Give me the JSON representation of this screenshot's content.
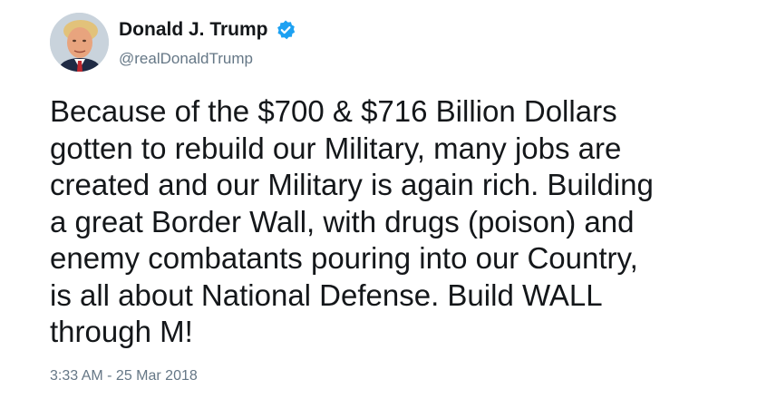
{
  "tweet": {
    "display_name": "Donald J. Trump",
    "handle": "@realDonaldTrump",
    "verified_color": "#1da1f2",
    "avatar": "profile-photo",
    "text_lines": [
      "Because of the $700 & $716 Billion Dollars",
      "gotten to rebuild our Military, many jobs are",
      "created and our Military is again rich. Building",
      "a great Border Wall, with drugs (poison) and",
      "enemy combatants pouring into our Country,",
      "is all about National Defense. Build WALL",
      "through M!"
    ],
    "timestamp": "3:33 AM - 25 Mar 2018"
  }
}
